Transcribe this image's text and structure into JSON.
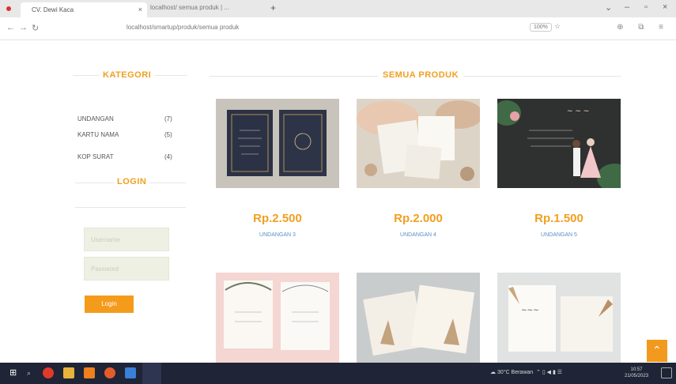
{
  "browser": {
    "tab_title": "CV. Dewi Kaca",
    "tab2_title": "localhost/ semua produk | ...",
    "url": "localhost/smartup/produk/semua produk",
    "zoom": "100%"
  },
  "sidebar": {
    "kategori_title": "KATEGORI",
    "categories": [
      {
        "name": "UNDANGAN",
        "count": "(7)"
      },
      {
        "name": "KARTU NAMA",
        "count": "(5)"
      },
      {
        "name": "KOP SURAT",
        "count": "(4)"
      }
    ],
    "login_title": "LOGIN",
    "username_placeholder": "Username",
    "password_placeholder": "Password",
    "login_button": "Login"
  },
  "main": {
    "title": "SEMUA PRODUK",
    "products": [
      {
        "price": "Rp.2.500",
        "name": "UNDANGAN 3"
      },
      {
        "price": "Rp.2.000",
        "name": "UNDANGAN 4"
      },
      {
        "price": "Rp.1.500",
        "name": "UNDANGAN 5"
      },
      {
        "price": "",
        "name": ""
      },
      {
        "price": "",
        "name": ""
      },
      {
        "price": "",
        "name": ""
      }
    ]
  },
  "taskbar": {
    "weather": "30°C Berawan",
    "time": "10:57",
    "date": "21/05/2023"
  }
}
